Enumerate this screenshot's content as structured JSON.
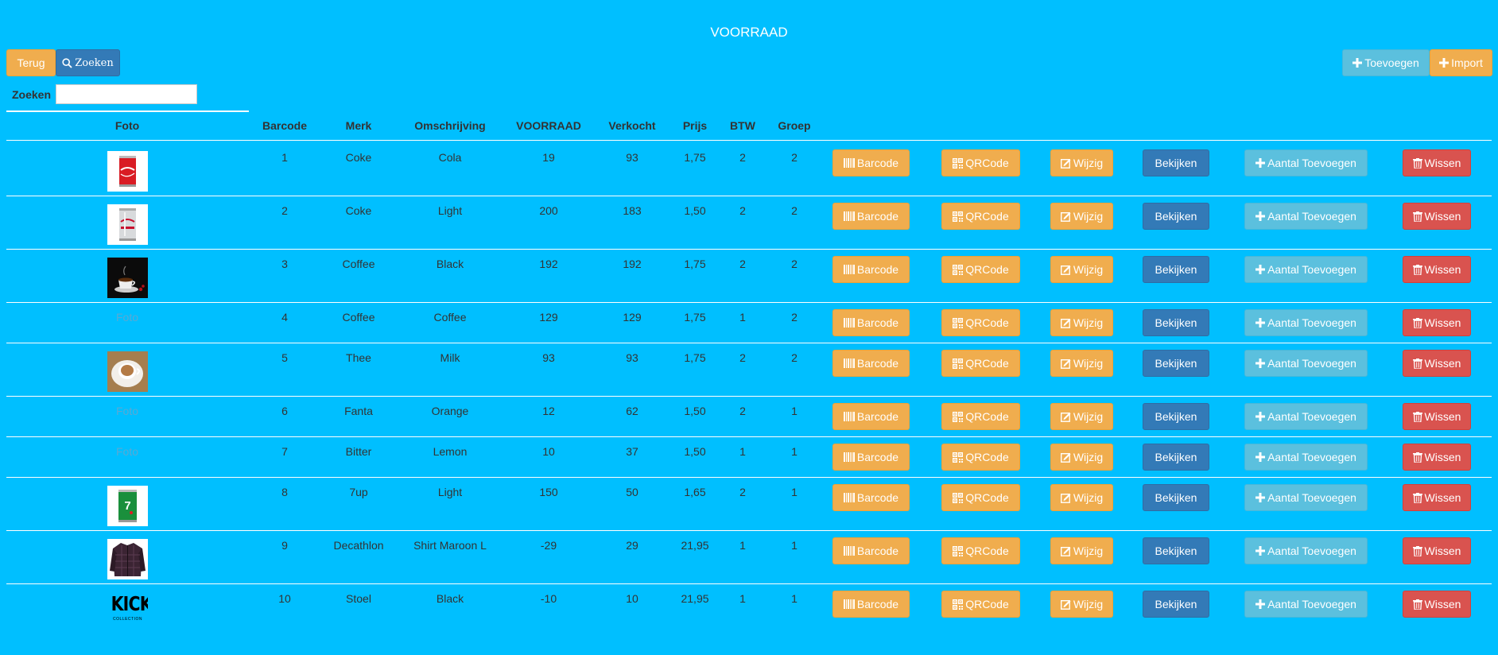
{
  "page": {
    "title": "VOORRAAD"
  },
  "toolbar": {
    "back_label": "Terug",
    "search_label": "Zoeken",
    "add_label": "Toevoegen",
    "import_label": "Import"
  },
  "search": {
    "label": "Zoeken",
    "value": ""
  },
  "columns": [
    "Foto",
    "Barcode",
    "Merk",
    "Omschrijving",
    "VOORRAAD",
    "Verkocht",
    "Prijs",
    "BTW",
    "Groep"
  ],
  "actions": {
    "barcode": "Barcode",
    "qrcode": "QRCode",
    "wijzig": "Wijzig",
    "bekijken": "Bekijken",
    "aantal": "Aantal Toevoegen",
    "wissen": "Wissen"
  },
  "photo_placeholder": "Foto",
  "rows": [
    {
      "barcode": "1",
      "merk": "Coke",
      "omschrijving": "Cola",
      "voorraad": "19",
      "verkocht": "93",
      "prijs": "1,75",
      "btw": "2",
      "groep": "2",
      "photo": "coke-can"
    },
    {
      "barcode": "2",
      "merk": "Coke",
      "omschrijving": "Light",
      "voorraad": "200",
      "verkocht": "183",
      "prijs": "1,50",
      "btw": "2",
      "groep": "2",
      "photo": "coke-light-can"
    },
    {
      "barcode": "3",
      "merk": "Coffee",
      "omschrijving": "Black",
      "voorraad": "192",
      "verkocht": "192",
      "prijs": "1,75",
      "btw": "2",
      "groep": "2",
      "photo": "coffee-cup"
    },
    {
      "barcode": "4",
      "merk": "Coffee",
      "omschrijving": "Coffee",
      "voorraad": "129",
      "verkocht": "129",
      "prijs": "1,75",
      "btw": "1",
      "groep": "2",
      "photo": ""
    },
    {
      "barcode": "5",
      "merk": "Thee",
      "omschrijving": "Milk",
      "voorraad": "93",
      "verkocht": "93",
      "prijs": "1,75",
      "btw": "2",
      "groep": "2",
      "photo": "milk-tea-cup"
    },
    {
      "barcode": "6",
      "merk": "Fanta",
      "omschrijving": "Orange",
      "voorraad": "12",
      "verkocht": "62",
      "prijs": "1,50",
      "btw": "2",
      "groep": "1",
      "photo": ""
    },
    {
      "barcode": "7",
      "merk": "Bitter",
      "omschrijving": "Lemon",
      "voorraad": "10",
      "verkocht": "37",
      "prijs": "1,50",
      "btw": "1",
      "groep": "1",
      "photo": ""
    },
    {
      "barcode": "8",
      "merk": "7up",
      "omschrijving": "Light",
      "voorraad": "150",
      "verkocht": "50",
      "prijs": "1,65",
      "btw": "2",
      "groep": "1",
      "photo": "7up-can"
    },
    {
      "barcode": "9",
      "merk": "Decathlon",
      "omschrijving": "Shirt Maroon L",
      "voorraad": "-29",
      "verkocht": "29",
      "prijs": "21,95",
      "btw": "1",
      "groep": "1",
      "photo": "shirt"
    },
    {
      "barcode": "10",
      "merk": "Stoel",
      "omschrijving": "Black",
      "voorraad": "-10",
      "verkocht": "10",
      "prijs": "21,95",
      "btw": "1",
      "groep": "1",
      "photo": "kick-logo",
      "logo_text": "KICK",
      "logo_subtext": "COLLECTION"
    }
  ],
  "colors": {
    "background": "#00bfff",
    "warning": "#f0ad4e",
    "primary": "#337ab7",
    "info": "#5bc0de",
    "danger": "#d9534f"
  }
}
